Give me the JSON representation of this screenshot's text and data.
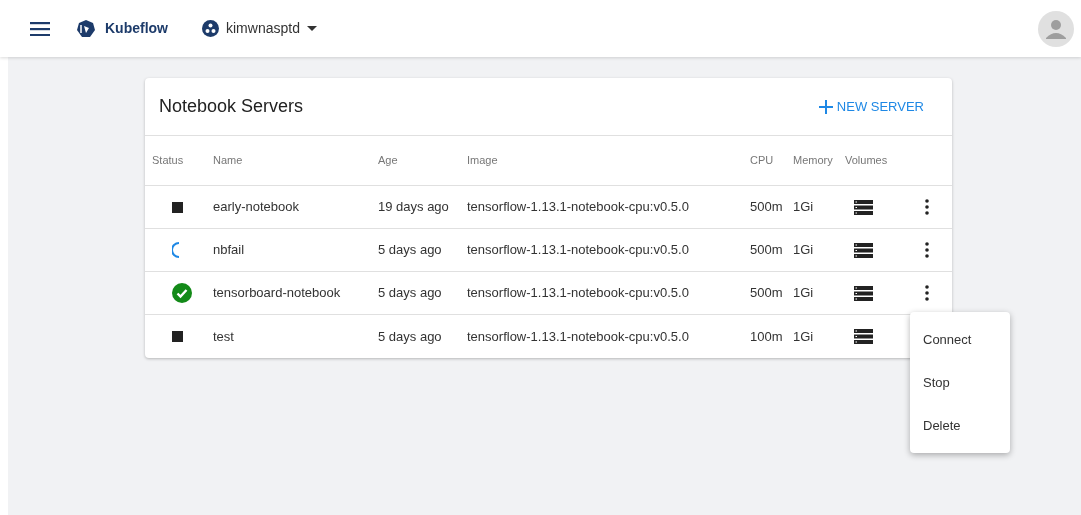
{
  "header": {
    "app_name": "Kubeflow",
    "namespace": "kimwnasptd"
  },
  "card": {
    "title": "Notebook Servers",
    "new_button": "NEW SERVER"
  },
  "table": {
    "columns": [
      "Status",
      "Name",
      "Age",
      "Image",
      "CPU",
      "Memory",
      "Volumes"
    ],
    "rows": [
      {
        "kind": "stopped",
        "name": "early-notebook",
        "age": "19 days ago",
        "image": "tensorflow-1.13.1-notebook-cpu:v0.5.0",
        "cpu": "500m",
        "memory": "1Gi"
      },
      {
        "kind": "waiting",
        "name": "nbfail",
        "age": "5 days ago",
        "image": "tensorflow-1.13.1-notebook-cpu:v0.5.0",
        "cpu": "500m",
        "memory": "1Gi"
      },
      {
        "kind": "running",
        "name": "tensorboard-notebook",
        "age": "5 days ago",
        "image": "tensorflow-1.13.1-notebook-cpu:v0.5.0",
        "cpu": "500m",
        "memory": "1Gi"
      },
      {
        "kind": "stopped",
        "name": "test",
        "age": "5 days ago",
        "image": "tensorflow-1.13.1-notebook-cpu:v0.5.0",
        "cpu": "100m",
        "memory": "1Gi"
      }
    ]
  },
  "menu": {
    "items": [
      "Connect",
      "Stop",
      "Delete"
    ]
  }
}
